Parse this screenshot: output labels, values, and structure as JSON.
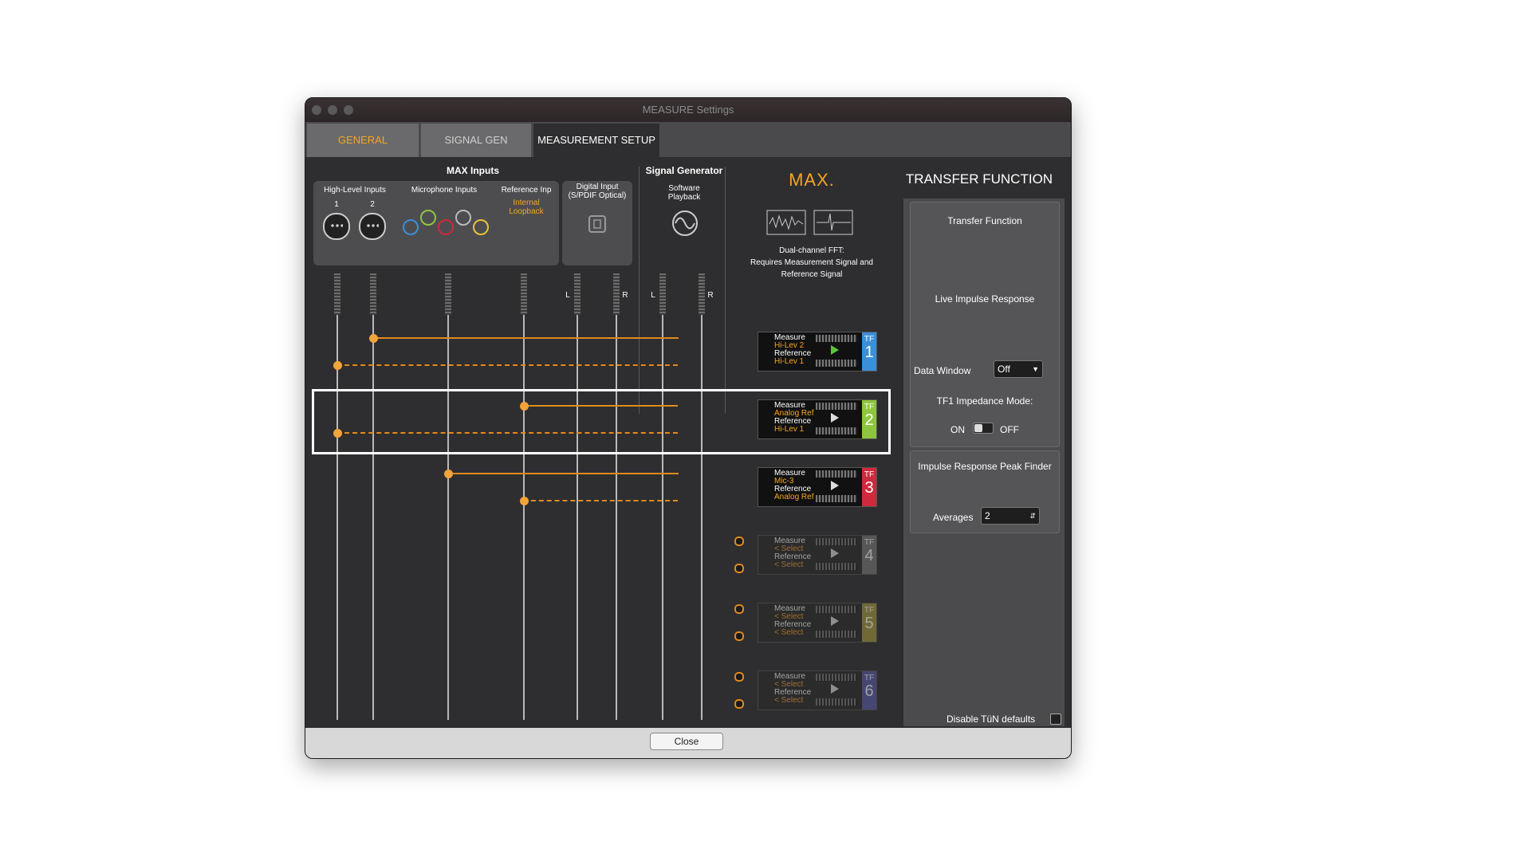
{
  "window": {
    "title": "MEASURE Settings"
  },
  "tabs": [
    {
      "label": "GENERAL"
    },
    {
      "label": "SIGNAL GEN"
    },
    {
      "label": "MEASUREMENT SETUP"
    }
  ],
  "inputs": {
    "heading": "MAX Inputs",
    "high_level": {
      "label": "High-Level Inputs",
      "ch1": "1",
      "ch2": "2"
    },
    "microphone": {
      "label": "Microphone Inputs"
    },
    "reference": {
      "label": "Reference Inp",
      "loopback_line1": "Internal",
      "loopback_line2": "Loopback"
    },
    "digital": {
      "label_line1": "Digital Input",
      "label_line2": "(S/PDIF Optical)",
      "l": "L",
      "r": "R"
    }
  },
  "signal_generator": {
    "heading": "Signal Generator",
    "label_line1": "Software",
    "label_line2": "Playback",
    "l": "L",
    "r": "R"
  },
  "brand": {
    "logo": "MAX.",
    "logo_color": "#f5a623",
    "fft_note_line1": "Dual-channel FFT:",
    "fft_note_line2": "Requires Measurement Signal and",
    "fft_note_line3": "Reference Signal"
  },
  "transfer_functions": [
    {
      "measure_label": "Measure",
      "measure_src": "Hi-Lev 2",
      "reference_label": "Reference",
      "reference_src": "Hi-Lev 1",
      "tf": "TF",
      "num": "1",
      "color": "#3a8fd8"
    },
    {
      "measure_label": "Measure",
      "measure_src": "Analog Ref",
      "reference_label": "Reference",
      "reference_src": "Hi-Lev 1",
      "tf": "TF",
      "num": "2",
      "color": "#8dc63f"
    },
    {
      "measure_label": "Measure",
      "measure_src": "Mic-3",
      "reference_label": "Reference",
      "reference_src": "Analog Ref",
      "tf": "TF",
      "num": "3",
      "color": "#d0283c"
    },
    {
      "measure_label": "Measure",
      "measure_src": "< Select",
      "reference_label": "Reference",
      "reference_src": "< Select",
      "tf": "TF",
      "num": "4",
      "color": "#7a7a7a"
    },
    {
      "measure_label": "Measure",
      "measure_src": "< Select",
      "reference_label": "Reference",
      "reference_src": "< Select",
      "tf": "TF",
      "num": "5",
      "color": "#a89a3a"
    },
    {
      "measure_label": "Measure",
      "measure_src": "< Select",
      "reference_label": "Reference",
      "reference_src": "< Select",
      "tf": "TF",
      "num": "6",
      "color": "#5a5aa8"
    }
  ],
  "right_panel": {
    "heading": "TRANSFER FUNCTION",
    "tf_label": "Transfer Function",
    "live_ir_label": "Live Impulse Response",
    "data_window_label": "Data Window",
    "data_window_value": "Off",
    "impedance_label": "TF1 Impedance Mode:",
    "on_label": "ON",
    "off_label": "OFF",
    "peak_finder_label": "Impulse Response Peak Finder",
    "averages_label": "Averages",
    "averages_value": "2",
    "disable_defaults_label": "Disable TüN defaults"
  },
  "footer": {
    "close_label": "Close"
  }
}
